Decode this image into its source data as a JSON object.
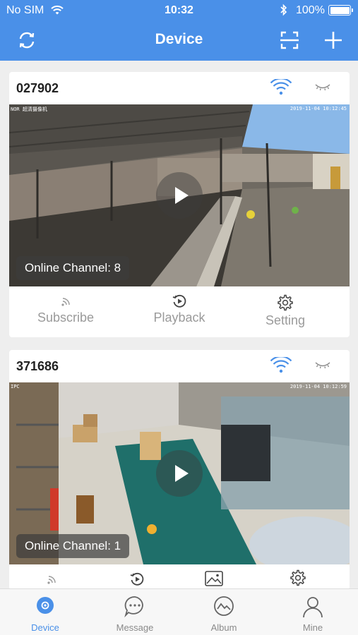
{
  "status": {
    "carrier": "No SIM",
    "time": "10:32",
    "battery": "100%"
  },
  "header": {
    "title": "Device"
  },
  "colors": {
    "accent": "#4a90e8",
    "inactive": "#9a9a9a"
  },
  "devices": [
    {
      "id": "027902",
      "channel_label": "Online Channel: 8",
      "timestamp": "2019-11-04 10:12:45",
      "osd_left": "NOR 超清摄像机",
      "actions": [
        "Subscribe",
        "Playback",
        "Setting"
      ]
    },
    {
      "id": "371686",
      "channel_label": "Online Channel: 1",
      "timestamp": "2019-11-04 10:12:59",
      "osd_left": "IPC"
    }
  ],
  "tabs": [
    {
      "label": "Device",
      "icon": "device-icon",
      "active": true
    },
    {
      "label": "Message",
      "icon": "message-icon",
      "active": false
    },
    {
      "label": "Album",
      "icon": "album-icon",
      "active": false
    },
    {
      "label": "Mine",
      "icon": "user-icon",
      "active": false
    }
  ]
}
